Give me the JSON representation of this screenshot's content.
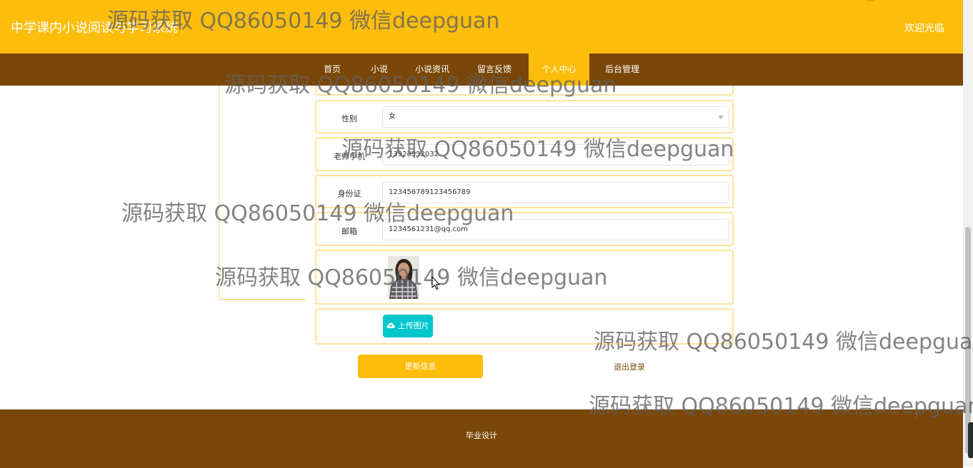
{
  "header": {
    "site_title": "中学课内小说阅读与学习系统",
    "welcome": "欢迎光临"
  },
  "nav": {
    "items": [
      {
        "label": "首页"
      },
      {
        "label": "小说"
      },
      {
        "label": "小说资讯"
      },
      {
        "label": "留言反馈"
      },
      {
        "label": "个人中心"
      },
      {
        "label": "后台管理"
      }
    ],
    "active": "个人中心"
  },
  "form": {
    "gender": {
      "label": "性别",
      "value": "女"
    },
    "teacher_phone": {
      "label": "老师手机",
      "value": "13923532032"
    },
    "id_card": {
      "label": "身份证",
      "value": "123456789123456789"
    },
    "email": {
      "label": "邮箱",
      "value": "1234561231@qq.com"
    },
    "upload_label": "上传图片",
    "update_label": "更新信息",
    "logout_label": "退出登录"
  },
  "footer": {
    "text": "毕业设计"
  },
  "watermark": "源码获取 QQ86050149 微信deepguan",
  "colors": {
    "primary": "#fdbd0b",
    "nav_bg": "#7a4708",
    "upload_button": "#00c7cc",
    "row_border": "#fbe49a"
  },
  "icons": [
    "cloud-upload-icon",
    "chevron-down-icon",
    "mouse-cursor-icon"
  ]
}
